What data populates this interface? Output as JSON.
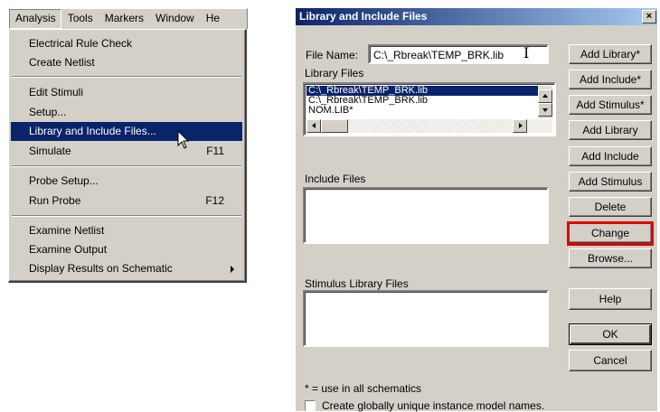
{
  "menubar": {
    "items": [
      "Analysis",
      "Tools",
      "Markers",
      "Window",
      "He"
    ]
  },
  "menu": {
    "items": [
      {
        "label": "Electrical Rule Check",
        "accel": ""
      },
      {
        "label": "Create Netlist",
        "accel": ""
      },
      {
        "label": "Edit Stimuli",
        "accel": ""
      },
      {
        "label": "Setup...",
        "accel": ""
      },
      {
        "label": "Library and Include Files...",
        "accel": ""
      },
      {
        "label": "Simulate",
        "accel": "F11"
      },
      {
        "label": "Probe Setup...",
        "accel": ""
      },
      {
        "label": "Run Probe",
        "accel": "F12"
      },
      {
        "label": "Examine Netlist",
        "accel": ""
      },
      {
        "label": "Examine Output",
        "accel": ""
      },
      {
        "label": "Display Results on Schematic",
        "accel": ""
      }
    ]
  },
  "dialog": {
    "title": "Library and Include Files",
    "close": "×",
    "file_name_label": "File Name:",
    "file_name_value": "C:\\_Rbreak\\TEMP_BRK.lib",
    "library_files_label": "Library Files",
    "library_files": [
      "C:\\_Rbreak\\TEMP_BRK.lib",
      "C:\\_Rbreak\\TEMP_BRK.lib",
      "NOM.LIB*"
    ],
    "include_files_label": "Include Files",
    "stimulus_files_label": "Stimulus Library Files",
    "footnote": "* = use in all schematics",
    "checkbox_label": "Create globally unique instance model names.",
    "buttons": {
      "add_library_star": "Add Library*",
      "add_include_star": "Add Include*",
      "add_stimulus_star": "Add Stimulus*",
      "add_library": "Add Library",
      "add_include": "Add Include",
      "add_stimulus": "Add Stimulus",
      "delete": "Delete",
      "change": "Change",
      "browse": "Browse...",
      "help": "Help",
      "ok": "OK",
      "cancel": "Cancel"
    },
    "highlight_color": "#e00000"
  }
}
